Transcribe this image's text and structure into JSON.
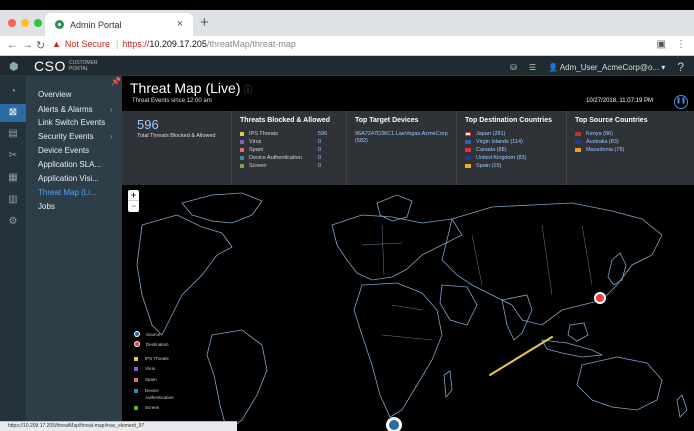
{
  "browser": {
    "tab_title": "Admin Portal",
    "new_tab": "+",
    "close": "×",
    "not_secure": "Not Secure",
    "url_scheme": "https://",
    "url_host": "10.209.17.205",
    "url_path": "/threatMap/threat-map",
    "status_url": "https://10.209.17.205/threatMap/threat-map#nav_element_97"
  },
  "header": {
    "brand": "CSO",
    "brand_sub_1": "CUSTOMER",
    "brand_sub_2": "PORTAL",
    "user": "Adm_User_AcmeCorp@o...",
    "help": "?"
  },
  "sidebar": {
    "items": [
      {
        "label": "Overview",
        "has_chevron": false
      },
      {
        "label": "Alerts & Alarms",
        "has_chevron": true
      },
      {
        "label": "Link Switch Events",
        "has_chevron": false
      },
      {
        "label": "Security Events",
        "has_chevron": true
      },
      {
        "label": "Device Events",
        "has_chevron": false
      },
      {
        "label": "Application SLA...",
        "has_chevron": false
      },
      {
        "label": "Application Visi...",
        "has_chevron": false
      },
      {
        "label": "Threat Map (Li...",
        "has_chevron": false
      },
      {
        "label": "Jobs",
        "has_chevron": false
      }
    ],
    "active_index": 7
  },
  "main": {
    "title": "Threat Map (Live)",
    "subtitle": "Threat Events since 12:00 am",
    "timestamp": "10/27/2018, 11:07:19 PM"
  },
  "stats": {
    "total": "596",
    "total_label": "Total Threats Blocked & Allowed",
    "blocked_header": "Threats Blocked & Allowed",
    "blocked": [
      {
        "label": "IPS Threats",
        "count": "596",
        "color": "#e8c84a"
      },
      {
        "label": "Virus",
        "count": "0",
        "color": "#8a5cc8"
      },
      {
        "label": "Spam",
        "count": "0",
        "color": "#e86a6a"
      },
      {
        "label": "Device Authentication",
        "count": "0",
        "color": "#3f8a9a"
      },
      {
        "label": "Screen",
        "count": "0",
        "color": "#6aaa4a"
      }
    ],
    "devices_header": "Top Target Devices",
    "devices": [
      "96A7247D36C1.LaeVegas.AcmeCorp",
      "(582)"
    ],
    "dest_header": "Top Destination Countries",
    "dest": [
      {
        "label": "Japan (281)",
        "flag": "#fff"
      },
      {
        "label": "Virgin Islands (114)",
        "flag": "#3a5fb0"
      },
      {
        "label": "Canada (88)",
        "flag": "#d33"
      },
      {
        "label": "United Kingdom (83)",
        "flag": "#2a3a8a"
      },
      {
        "label": "Spain (15)",
        "flag": "#e8b020"
      }
    ],
    "src_header": "Top Source Countries",
    "src": [
      {
        "label": "Kenya (86)",
        "flag": "#b33"
      },
      {
        "label": "Australia (83)",
        "flag": "#2a3a8a"
      },
      {
        "label": "Macedonia (79)",
        "flag": "#e8a020"
      }
    ]
  },
  "map": {
    "zoom_in": "+",
    "zoom_out": "−",
    "legend": {
      "source": "Source",
      "destination": "Destination",
      "ips": "IPS Threats",
      "virus": "Virus",
      "spam": "Spam",
      "device_1": "Device",
      "device_2": "Authentication",
      "screen": "Screen"
    }
  }
}
